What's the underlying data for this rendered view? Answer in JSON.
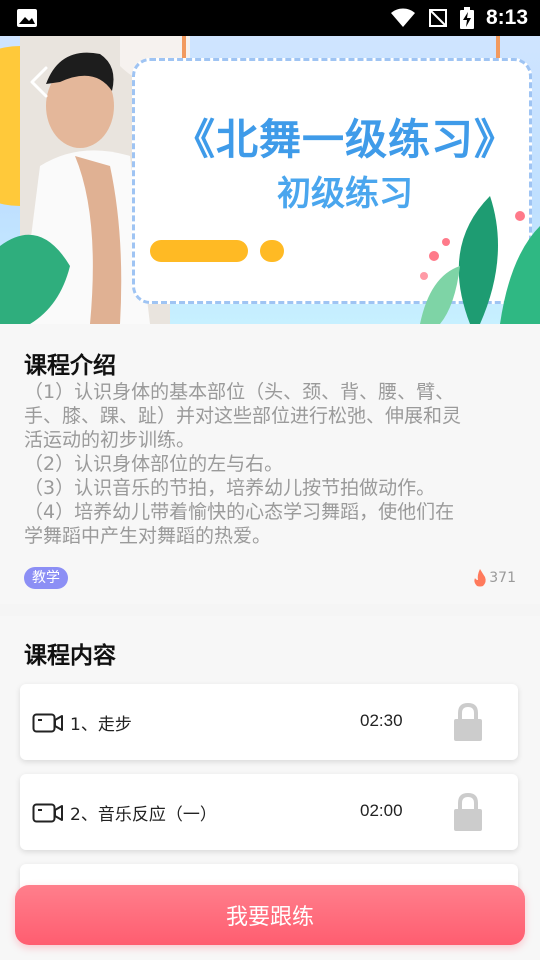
{
  "status_bar": {
    "time": "8:13",
    "icons": [
      "image-icon",
      "wifi-icon",
      "no-signal-icon",
      "battery-charging-icon"
    ]
  },
  "banner": {
    "title": "《北舞一级练习》",
    "subtitle": "初级练习"
  },
  "intro": {
    "heading": "课程介绍",
    "lines": [
      "（1）认识身体的基本部位（头、颈、背、腰、臂、",
      "手、膝、踝、趾）并对这些部位进行松弛、伸展和灵",
      "活运动的初步训练。",
      "（2）认识身体部位的左与右。",
      "（3）认识音乐的节拍，培养幼儿按节拍做动作。",
      "（4）培养幼儿带着愉快的心态学习舞蹈，使他们在",
      "学舞蹈中产生对舞蹈的热爱。"
    ],
    "tag": "教学",
    "hot_count": "371",
    "accent": "#8c8ff5"
  },
  "content": {
    "heading": "课程内容",
    "lessons": [
      {
        "title": "1、走步",
        "duration": "02:30",
        "locked": true
      },
      {
        "title": "2、音乐反应（一）",
        "duration": "02:00",
        "locked": true
      }
    ]
  },
  "cta": {
    "label": "我要跟练",
    "color": "#ff6a7b"
  }
}
